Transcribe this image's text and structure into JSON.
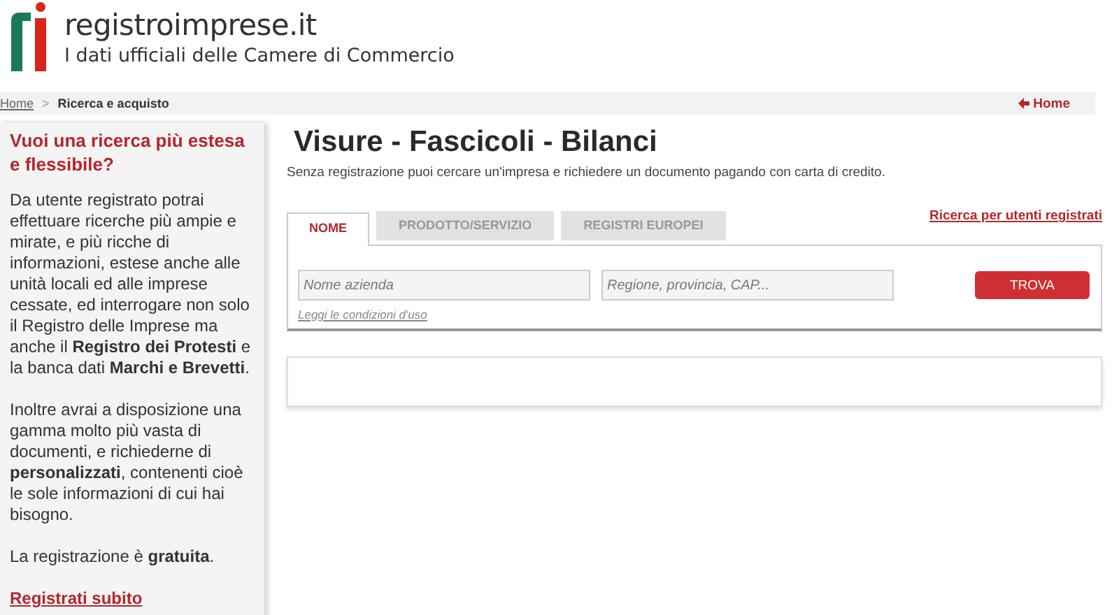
{
  "header": {
    "site": "registroimprese.it",
    "tagline": "I dati ufficiali delle Camere di Commercio"
  },
  "breadcrumb": {
    "items": [
      {
        "label": "Home",
        "kind": "link"
      },
      {
        "label": ">",
        "kind": "separator"
      },
      {
        "label": "Ricerca e acquisto",
        "kind": "current"
      }
    ],
    "home_link": "Home"
  },
  "sidebar": {
    "title": "Vuoi una ricerca più estesa e flessibile?",
    "paragraphs": [
      "Da utente registrato potrai effettuare ricerche più ampie e mirate, e più ricche di informazioni, estese anche alle unità locali ed alle imprese cessate, ed interrogare non solo il Registro delle Imprese ma anche il **Registro dei Protesti** e la banca dati **Marchi e Brevetti**.",
      "Inoltre avrai a disposizione una gamma molto più vasta di documenti, e richiederne di **personalizzati**, contenenti cioè le sole informazioni di cui hai bisogno.",
      "La registrazione è **gratuita**."
    ],
    "link": "Registrati subito"
  },
  "main": {
    "title": "Visure - Fascicoli - Bilanci",
    "subtitle": "Senza registrazione puoi cercare un'impresa e richiedere un documento pagando con carta di credito.",
    "tabs": [
      {
        "label": "NOME",
        "selected": true
      },
      {
        "label": "PRODOTTO/SERVIZIO",
        "selected": false
      },
      {
        "label": "REGISTRI EUROPEI",
        "selected": false
      }
    ],
    "registered_link": "Ricerca per utenti registrati",
    "fields": [
      {
        "placeholder": "Nome azienda"
      },
      {
        "placeholder": "Regione, provincia, CAP..."
      }
    ],
    "button": "TROVA",
    "terms_link": "Leggi le condizioni d'uso"
  }
}
